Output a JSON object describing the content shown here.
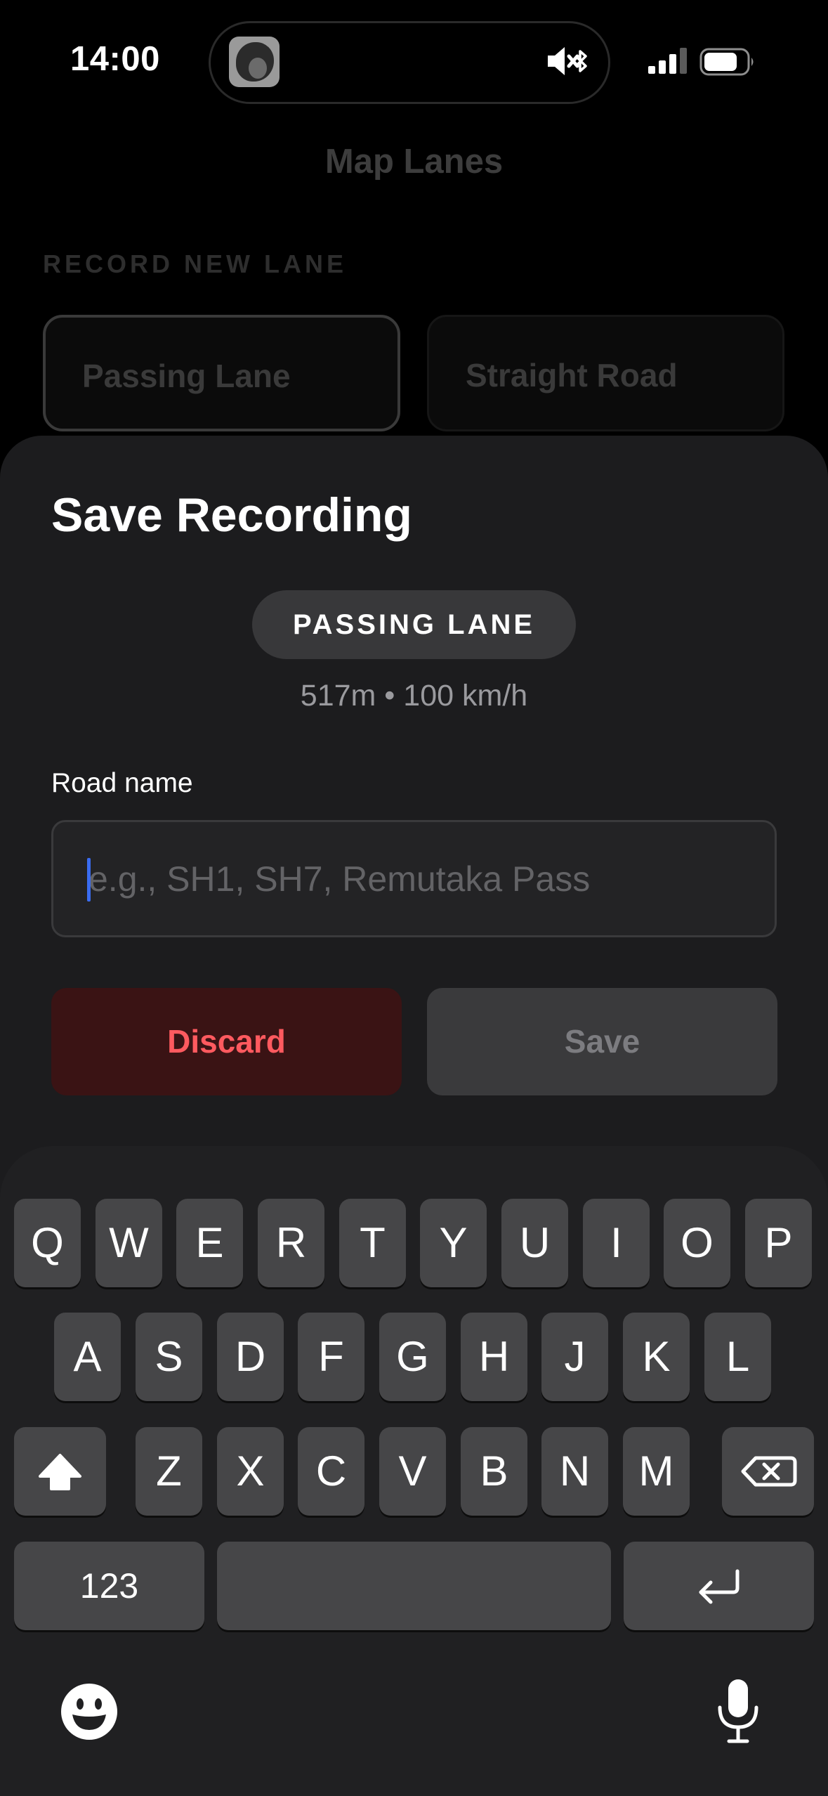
{
  "status_bar": {
    "time": "14:00",
    "icons": [
      "now-playing-artwork",
      "speaker-muted-icon",
      "bluetooth-icon",
      "cellular-signal-icon",
      "battery-icon"
    ]
  },
  "background_screen": {
    "title": "Map Lanes",
    "section_label": "RECORD NEW LANE",
    "cards": [
      "Passing Lane",
      "Straight Road"
    ]
  },
  "sheet": {
    "title": "Save Recording",
    "lane_type_chip": "PASSING LANE",
    "meta": "517m • 100 km/h",
    "road_name_label": "Road name",
    "road_name_value": "",
    "road_name_placeholder": "e.g., SH1, SH7, Remutaka Pass",
    "discard_label": "Discard",
    "save_label": "Save"
  },
  "keyboard": {
    "row1": [
      "Q",
      "W",
      "E",
      "R",
      "T",
      "Y",
      "U",
      "I",
      "O",
      "P"
    ],
    "row2": [
      "A",
      "S",
      "D",
      "F",
      "G",
      "H",
      "J",
      "K",
      "L"
    ],
    "row3": [
      "Z",
      "X",
      "C",
      "V",
      "B",
      "N",
      "M"
    ],
    "numbers_label": "123",
    "space_label": "",
    "icons": [
      "shift-icon",
      "backspace-icon",
      "return-icon",
      "emoji-icon",
      "microphone-icon"
    ]
  },
  "colors": {
    "sheet_bg": "#1c1c1e",
    "discard_bg": "#3a1314",
    "discard_text": "#ff5a5f",
    "save_bg": "#3a3a3c",
    "save_text": "#7c7c80",
    "caret": "#3a6cf0"
  }
}
